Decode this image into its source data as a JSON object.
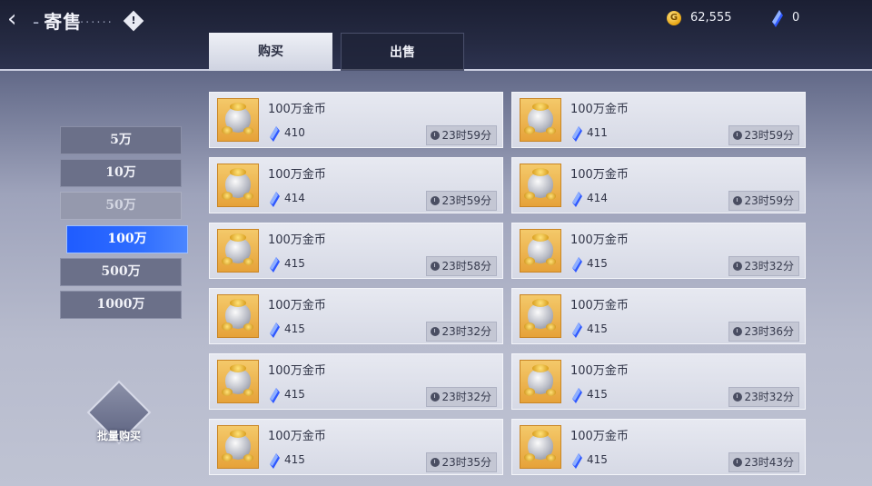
{
  "header": {
    "title": "寄售",
    "dots": "......",
    "info_icon": "!",
    "gold": "62,555",
    "gems": "0"
  },
  "tabs": [
    {
      "label": "购买"
    },
    {
      "label": "出售"
    }
  ],
  "side_menu": [
    {
      "label": "5万",
      "state": "normal"
    },
    {
      "label": "10万",
      "state": "normal"
    },
    {
      "label": "50万",
      "state": "disabled"
    },
    {
      "label": "100万",
      "state": "active"
    },
    {
      "label": "500万",
      "state": "normal"
    },
    {
      "label": "1000万",
      "state": "normal"
    }
  ],
  "bulk_buy": {
    "label": "批量购买"
  },
  "listings": [
    {
      "name": "100万金币",
      "price": "410",
      "time": "23时59分"
    },
    {
      "name": "100万金币",
      "price": "411",
      "time": "23时59分"
    },
    {
      "name": "100万金币",
      "price": "414",
      "time": "23时59分"
    },
    {
      "name": "100万金币",
      "price": "414",
      "time": "23时59分"
    },
    {
      "name": "100万金币",
      "price": "415",
      "time": "23时58分"
    },
    {
      "name": "100万金币",
      "price": "415",
      "time": "23时32分"
    },
    {
      "name": "100万金币",
      "price": "415",
      "time": "23时32分"
    },
    {
      "name": "100万金币",
      "price": "415",
      "time": "23时36分"
    },
    {
      "name": "100万金币",
      "price": "415",
      "time": "23时32分"
    },
    {
      "name": "100万金币",
      "price": "415",
      "time": "23时32分"
    },
    {
      "name": "100万金币",
      "price": "415",
      "time": "23时35分"
    },
    {
      "name": "100万金币",
      "price": "415",
      "time": "23时43分"
    }
  ],
  "colors": {
    "accent": "#2f6dff",
    "gem": "#3d6cff",
    "coin": "#e8a510"
  }
}
